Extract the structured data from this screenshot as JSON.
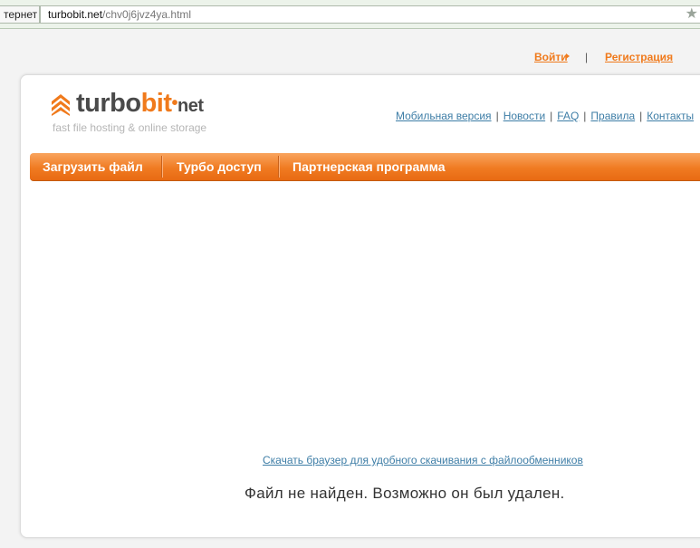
{
  "browser": {
    "tab_label": "тернет",
    "url_domain": "turbobit.net",
    "url_path": "/chv0j6jvz4ya.html",
    "bookmark_icon": "star-icon"
  },
  "top_links": {
    "login": "Войти",
    "separator": "|",
    "register": "Регистрация"
  },
  "logo": {
    "part1": "turbo",
    "part2": "bit",
    "dot": "•",
    "part3": "net",
    "tagline": "fast file hosting & online storage",
    "icon": "chevrons-up-icon"
  },
  "header_links": [
    "Мобильная версия",
    "Новости",
    "FAQ",
    "Правила",
    "Контакты"
  ],
  "nav": {
    "upload": "Загрузить файл",
    "turbo": "Турбо доступ",
    "partner": "Партнерская программа"
  },
  "content": {
    "browser_link": "Скачать браузер для удобного скачивания с файлообменников",
    "message": "Файл не найден. Возможно он был удален."
  },
  "colors": {
    "accent_orange": "#f07a1c",
    "link_blue": "#3d7da6"
  }
}
